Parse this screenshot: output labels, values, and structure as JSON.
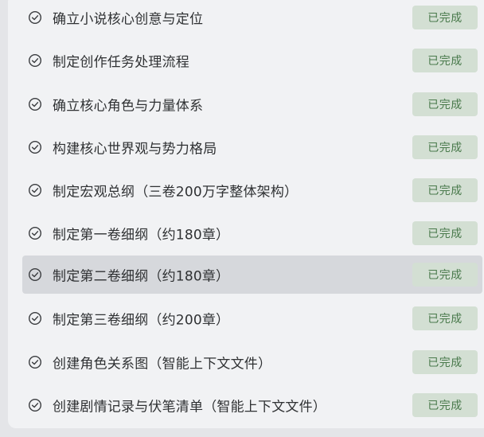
{
  "colors": {
    "row_highlight": "#d6d8dc",
    "badge_bg": "#d3dfd3",
    "badge_text": "#4a7a4c",
    "panel_bg": "#f1f2f4"
  },
  "tasks": [
    {
      "label": "确立小说核心创意与定位",
      "status": "已完成",
      "icon": "check-circle-icon"
    },
    {
      "label": "制定创作任务处理流程",
      "status": "已完成",
      "icon": "check-circle-icon"
    },
    {
      "label": "确立核心角色与力量体系",
      "status": "已完成",
      "icon": "check-circle-icon"
    },
    {
      "label": "构建核心世界观与势力格局",
      "status": "已完成",
      "icon": "check-circle-icon"
    },
    {
      "label": "制定宏观总纲（三卷200万字整体架构）",
      "status": "已完成",
      "icon": "check-circle-icon"
    },
    {
      "label": "制定第一卷细纲（约180章）",
      "status": "已完成",
      "icon": "check-circle-icon"
    },
    {
      "label": "制定第二卷细纲（约180章）",
      "status": "已完成",
      "icon": "check-circle-icon",
      "highlighted": true
    },
    {
      "label": "制定第三卷细纲（约200章）",
      "status": "已完成",
      "icon": "check-circle-icon"
    },
    {
      "label": "创建角色关系图（智能上下文文件）",
      "status": "已完成",
      "icon": "check-circle-icon"
    },
    {
      "label": "创建剧情记录与伏笔清单（智能上下文文件）",
      "status": "已完成",
      "icon": "check-circle-icon"
    }
  ]
}
